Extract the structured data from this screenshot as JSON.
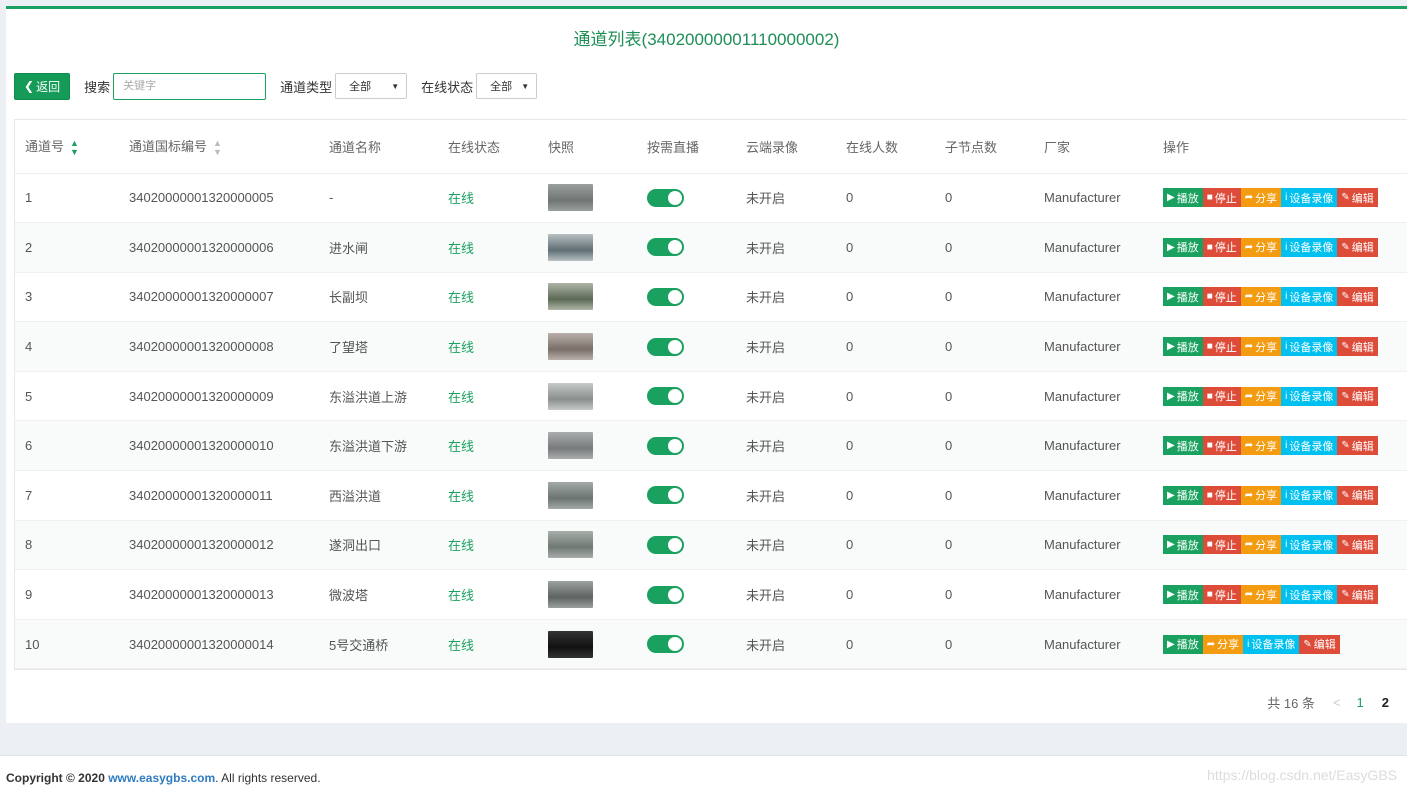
{
  "page": {
    "title": "通道列表(34020000001110000002)"
  },
  "toolbar": {
    "back_label": "返回",
    "search_label": "搜索",
    "search_placeholder": "关键字",
    "channel_type_label": "通道类型",
    "channel_type_value": "全部",
    "online_status_label": "在线状态",
    "online_status_value": "全部"
  },
  "table": {
    "columns": [
      "通道号",
      "通道国标编号",
      "通道名称",
      "在线状态",
      "快照",
      "按需直播",
      "云端录像",
      "在线人数",
      "子节点数",
      "厂家",
      "操作"
    ],
    "actions": {
      "play": "播放",
      "stop": "停止",
      "share": "分享",
      "record": "设备录像",
      "edit": "编辑"
    },
    "rows": [
      {
        "id": "1",
        "code": "34020000001320000005",
        "name": "-",
        "status": "在线",
        "cloud": "未开启",
        "online": "0",
        "children": "0",
        "vendor": "Manufacturer",
        "has_stop": true
      },
      {
        "id": "2",
        "code": "34020000001320000006",
        "name": "进水闸",
        "status": "在线",
        "cloud": "未开启",
        "online": "0",
        "children": "0",
        "vendor": "Manufacturer",
        "has_stop": true
      },
      {
        "id": "3",
        "code": "34020000001320000007",
        "name": "长副坝",
        "status": "在线",
        "cloud": "未开启",
        "online": "0",
        "children": "0",
        "vendor": "Manufacturer",
        "has_stop": true
      },
      {
        "id": "4",
        "code": "34020000001320000008",
        "name": "了望塔",
        "status": "在线",
        "cloud": "未开启",
        "online": "0",
        "children": "0",
        "vendor": "Manufacturer",
        "has_stop": true
      },
      {
        "id": "5",
        "code": "34020000001320000009",
        "name": "东溢洪道上游",
        "status": "在线",
        "cloud": "未开启",
        "online": "0",
        "children": "0",
        "vendor": "Manufacturer",
        "has_stop": true
      },
      {
        "id": "6",
        "code": "34020000001320000010",
        "name": "东溢洪道下游",
        "status": "在线",
        "cloud": "未开启",
        "online": "0",
        "children": "0",
        "vendor": "Manufacturer",
        "has_stop": true
      },
      {
        "id": "7",
        "code": "34020000001320000011",
        "name": "西溢洪道",
        "status": "在线",
        "cloud": "未开启",
        "online": "0",
        "children": "0",
        "vendor": "Manufacturer",
        "has_stop": true
      },
      {
        "id": "8",
        "code": "34020000001320000012",
        "name": "遂洞出口",
        "status": "在线",
        "cloud": "未开启",
        "online": "0",
        "children": "0",
        "vendor": "Manufacturer",
        "has_stop": true
      },
      {
        "id": "9",
        "code": "34020000001320000013",
        "name": "微波塔",
        "status": "在线",
        "cloud": "未开启",
        "online": "0",
        "children": "0",
        "vendor": "Manufacturer",
        "has_stop": true
      },
      {
        "id": "10",
        "code": "34020000001320000014",
        "name": "5号交通桥",
        "status": "在线",
        "cloud": "未开启",
        "online": "0",
        "children": "0",
        "vendor": "Manufacturer",
        "has_stop": false
      }
    ]
  },
  "pagination": {
    "total": "共 16 条",
    "prev": "<",
    "pages": [
      "1",
      "2"
    ],
    "current": "1"
  },
  "footer": {
    "copyright_prefix": "Copyright © 2020",
    "link": "www.easygbs.com",
    "suffix": ". All rights reserved.",
    "watermark": "https://blog.csdn.net/EasyGBS"
  },
  "colors": {
    "primary": "#1aa15f",
    "danger": "#dd4b39",
    "warning": "#f39c12",
    "info": "#00c0ef"
  }
}
